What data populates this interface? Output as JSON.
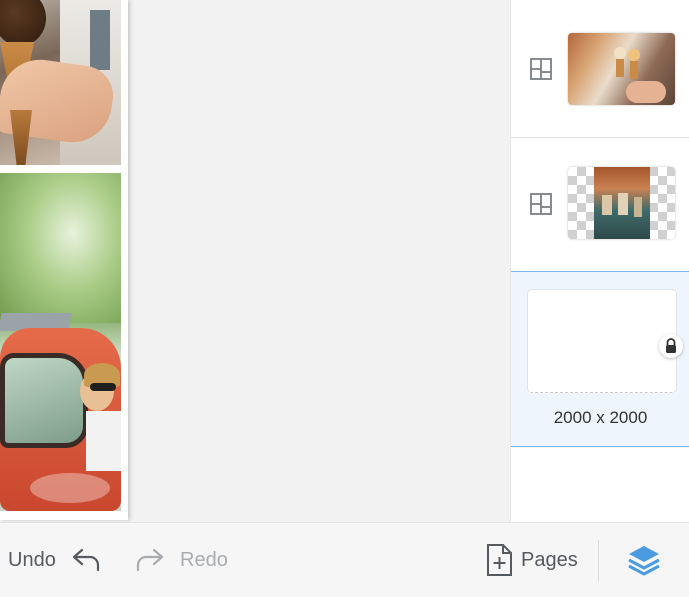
{
  "canvas": {
    "photos": [
      "ice-cream-cone-photo",
      "orange-vintage-car-photo"
    ]
  },
  "layers_panel": {
    "rows": [
      {
        "type": "photo-layer",
        "icon": "layout-grid-icon",
        "thumbnail": "ice-cream-street-thumbnail"
      },
      {
        "type": "cutout-layer",
        "icon": "layout-grid-icon",
        "thumbnail": "street-cafe-transparent-thumbnail"
      },
      {
        "type": "background-layer",
        "locked": true,
        "dimensions": "2000 x 2000"
      }
    ]
  },
  "toolbar": {
    "undo_label": "Undo",
    "redo_label": "Redo",
    "pages_label": "Pages",
    "layers_icon": "layers-icon"
  },
  "colors": {
    "accent": "#4a9be0",
    "selection_bg": "#eef5fd",
    "toolbar_text": "#555a60",
    "disabled_text": "#a8acb0"
  }
}
